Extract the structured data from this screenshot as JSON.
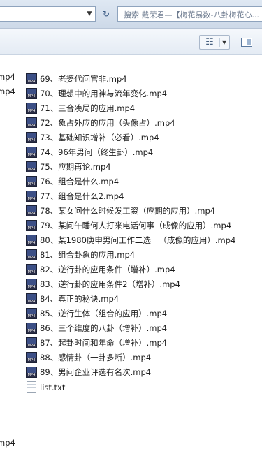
{
  "address_bar": {
    "dropdown_icon": "chevron-down-icon",
    "refresh_icon": "refresh-icon",
    "search_placeholder": "搜索 戴荣君—【梅花易数-八卦梅花心..."
  },
  "toolbar": {
    "view_icon": "view-grid-icon",
    "view_dropdown_icon": "chevron-down-icon",
    "preview_pane_icon": "preview-pane-icon"
  },
  "left_column": {
    "items": [
      "mp4",
      "mp4",
      "mp4"
    ]
  },
  "files": [
    {
      "name": "69、老婆代问官非.mp4",
      "type": "mp4"
    },
    {
      "name": "70、理想中的用神与流年变化.mp4",
      "type": "mp4"
    },
    {
      "name": "71、三合凑局的应用.mp4",
      "type": "mp4"
    },
    {
      "name": "72、象占外应的应用（头像占）.mp4",
      "type": "mp4"
    },
    {
      "name": "73、基础知识增补（必看）.mp4",
      "type": "mp4"
    },
    {
      "name": "74、96年男问（终生卦）.mp4",
      "type": "mp4"
    },
    {
      "name": "75、应期再论.mp4",
      "type": "mp4"
    },
    {
      "name": "76、组合是什么.mp4",
      "type": "mp4"
    },
    {
      "name": "77、组合是什么2.mp4",
      "type": "mp4"
    },
    {
      "name": "78、某女问什么时候发工资（应期的应用）.mp4",
      "type": "mp4"
    },
    {
      "name": "79、某问午睡何人打来电话何事（成像的应用）.mp4",
      "type": "mp4"
    },
    {
      "name": "80、某1980庚申男问工作二选一（成像的应用）.mp4",
      "type": "mp4"
    },
    {
      "name": "81、组合卦象的应用.mp4",
      "type": "mp4"
    },
    {
      "name": "82、逆行卦的应用条件（增补）.mp4",
      "type": "mp4"
    },
    {
      "name": "83、逆行卦的应用条件2（增补）.mp4",
      "type": "mp4"
    },
    {
      "name": "84、真正的秘诀.mp4",
      "type": "mp4"
    },
    {
      "name": "85、逆行生体（组合的应用）.mp4",
      "type": "mp4"
    },
    {
      "name": "86、三个维度的八卦（增补）.mp4",
      "type": "mp4"
    },
    {
      "name": "87、起卦时间和年命（增补）.mp4",
      "type": "mp4"
    },
    {
      "name": "88、感情卦（一卦多断）.mp4",
      "type": "mp4"
    },
    {
      "name": "89、男问企业评选有名次.mp4",
      "type": "mp4"
    },
    {
      "name": "list.txt",
      "type": "txt"
    }
  ],
  "colors": {
    "accent": "#3c4f86",
    "toolbar_bg": "#e4ebf4"
  }
}
